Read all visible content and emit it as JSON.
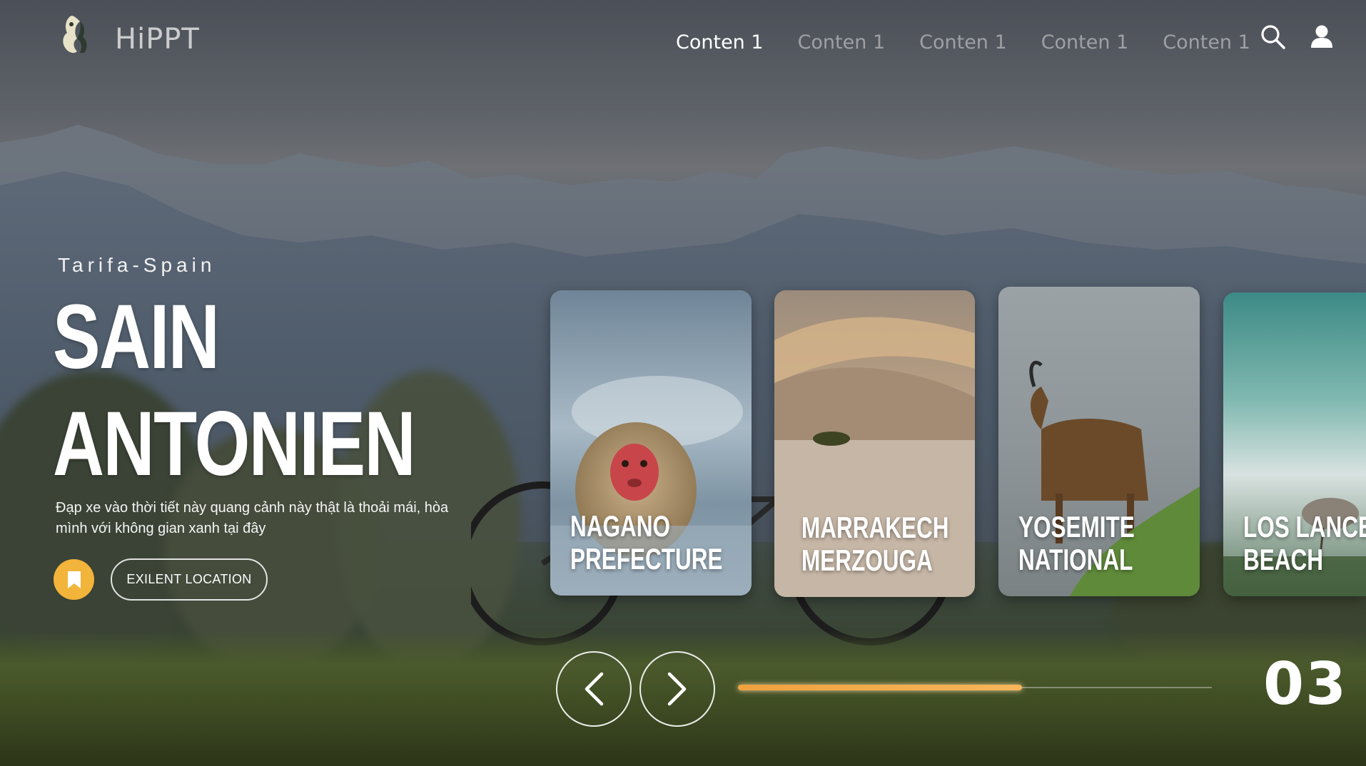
{
  "brand": {
    "name": "HiPPT"
  },
  "nav": {
    "items": [
      {
        "label": "Conten 1",
        "active": true
      },
      {
        "label": "Conten 1",
        "active": false
      },
      {
        "label": "Conten 1",
        "active": false
      },
      {
        "label": "Conten 1",
        "active": false
      },
      {
        "label": "Conten 1",
        "active": false
      }
    ],
    "icons": [
      "search-icon",
      "user-icon"
    ]
  },
  "hero": {
    "subtitle": "Tarifa-Spain",
    "title_line1": "SAIN",
    "title_line2": "ANTONIEN",
    "description": "Đạp xe vào thời tiết này quang cảnh này thật là thoải mái, hòa mình với không gian xanh tại đây",
    "location_button": "EXILENT LOCATION"
  },
  "cards": [
    {
      "line1": "NAGANO",
      "line2": "PREFECTURE"
    },
    {
      "line1": "MARRAKECH",
      "line2": "MERZOUGA"
    },
    {
      "line1": "YOSEMITE",
      "line2": "NATIONAL"
    },
    {
      "line1": "LOS LANCES",
      "line2": "BEACH"
    }
  ],
  "slider": {
    "counter": "03",
    "progress": 0.6
  },
  "colors": {
    "accent": "#f2b43a",
    "progress": "#f0a140"
  }
}
